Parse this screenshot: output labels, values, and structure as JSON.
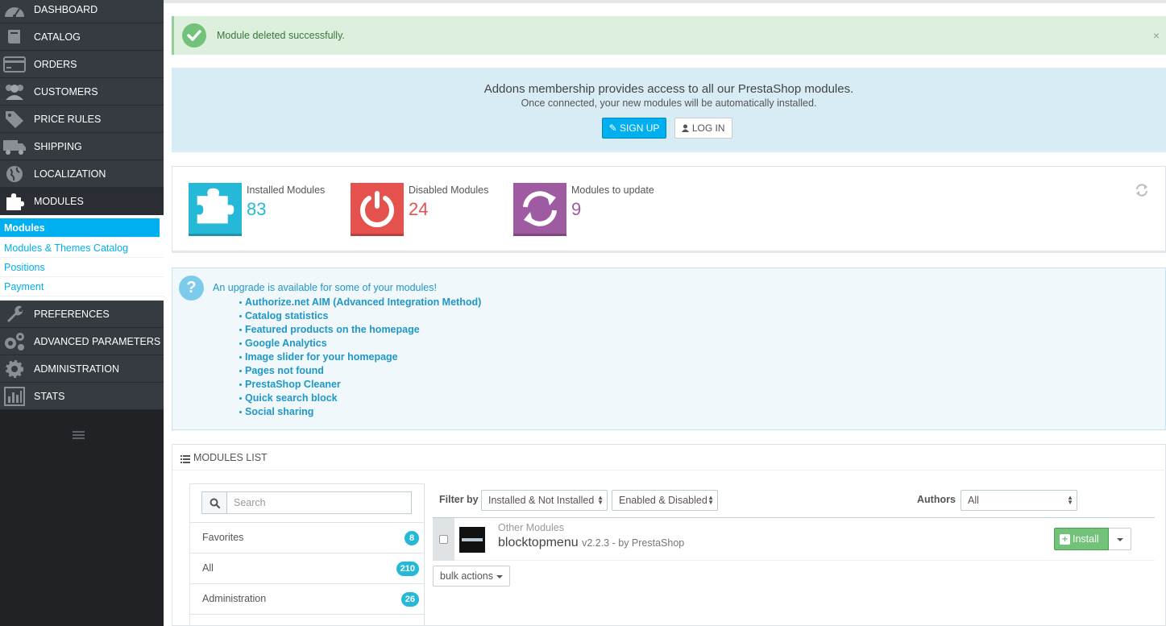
{
  "sidebar": {
    "items": [
      {
        "label": "DASHBOARD",
        "icon": "dashboard-icon"
      },
      {
        "label": "CATALOG",
        "icon": "book-icon"
      },
      {
        "label": "ORDERS",
        "icon": "credit-card-icon"
      },
      {
        "label": "CUSTOMERS",
        "icon": "users-icon"
      },
      {
        "label": "PRICE RULES",
        "icon": "tags-icon"
      },
      {
        "label": "SHIPPING",
        "icon": "truck-icon"
      },
      {
        "label": "LOCALIZATION",
        "icon": "globe-icon"
      },
      {
        "label": "MODULES",
        "icon": "puzzle-icon"
      },
      {
        "label": "PREFERENCES",
        "icon": "wrench-icon"
      },
      {
        "label": "ADVANCED PARAMETERS",
        "icon": "cogs-icon"
      },
      {
        "label": "ADMINISTRATION",
        "icon": "gear-icon"
      },
      {
        "label": "STATS",
        "icon": "bar-chart-icon"
      }
    ],
    "submenu": [
      "Modules",
      "Modules & Themes Catalog",
      "Positions",
      "Payment"
    ],
    "active_submenu": "Modules"
  },
  "alert": {
    "message": "Module deleted successfully.",
    "close": "×"
  },
  "addons": {
    "title": "Addons membership provides access to all our PrestaShop modules.",
    "subtitle": "Once connected, your new modules will be automatically installed.",
    "signup": "SIGN UP",
    "login": "LOG IN"
  },
  "stats": {
    "installed": {
      "label": "Installed Modules",
      "value": "83",
      "color": "#25b9d7"
    },
    "disabled": {
      "label": "Disabled Modules",
      "value": "24",
      "color": "#e5524d"
    },
    "update": {
      "label": "Modules to update",
      "value": "9",
      "color": "#9e5ba1"
    }
  },
  "upgrade": {
    "heading": "An upgrade is available for some of your modules!",
    "modules": [
      "Authorize.net AIM (Advanced Integration Method)",
      "Catalog statistics",
      "Featured products on the homepage",
      "Google Analytics",
      "Image slider for your homepage",
      "Pages not found",
      "PrestaShop Cleaner",
      "Quick search block",
      "Social sharing"
    ]
  },
  "modules_list": {
    "title": "MODULES LIST",
    "search_placeholder": "Search",
    "categories": [
      {
        "label": "Favorites",
        "count": "8"
      },
      {
        "label": "All",
        "count": "210"
      },
      {
        "label": "Administration",
        "count": "26"
      }
    ],
    "filter_label": "Filter by",
    "filter_install": "Installed & Not Installed",
    "filter_status": "Enabled & Disabled",
    "authors_label": "Authors",
    "authors_value": "All",
    "module": {
      "category": "Other Modules",
      "name": "blocktopmenu",
      "version": "v2.2.3 - by PrestaShop",
      "install": "Install"
    },
    "bulk_actions": "bulk actions"
  }
}
